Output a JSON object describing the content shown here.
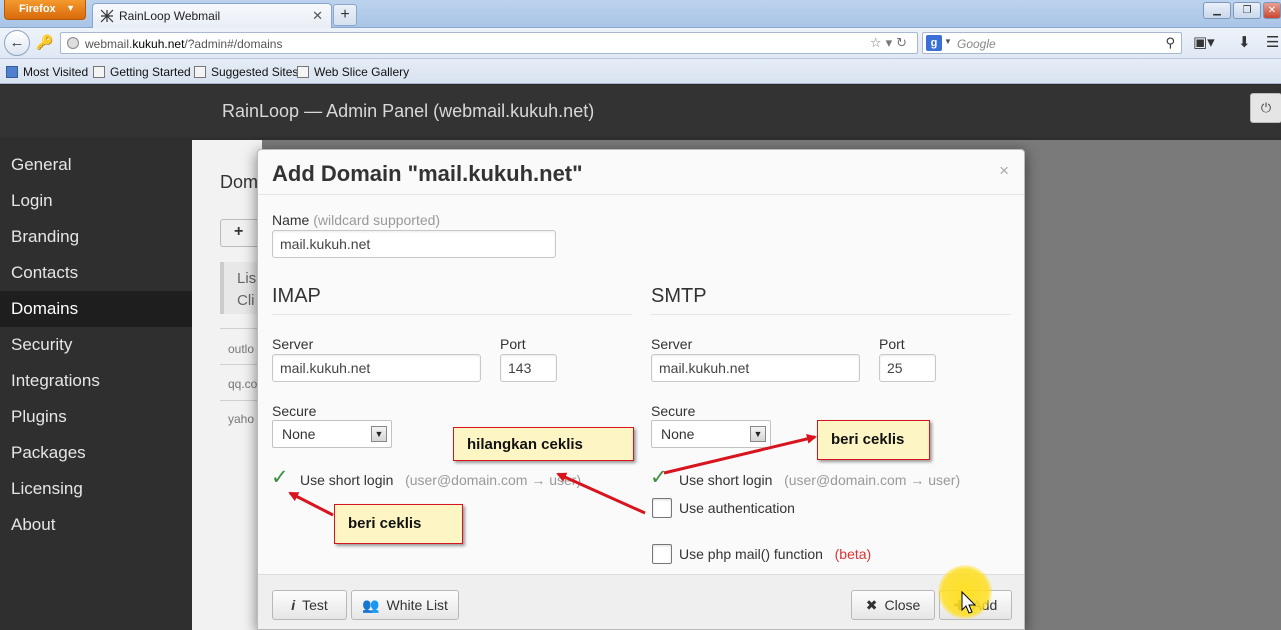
{
  "browser": {
    "menu_button": "Firefox",
    "tab_title": "RainLoop Webmail",
    "new_tab_label": "+",
    "url_prefix": "webmail.",
    "url_domain": "kukuh.net",
    "url_suffix": "/?admin#/domains",
    "search_placeholder": "Google",
    "bookmarks": [
      "Most Visited",
      "Getting Started",
      "Suggested Sites",
      "Web Slice Gallery"
    ]
  },
  "app": {
    "title": "RainLoop — Admin Panel  (webmail.kukuh.net)",
    "sidebar": [
      {
        "label": "General"
      },
      {
        "label": "Login"
      },
      {
        "label": "Branding"
      },
      {
        "label": "Contacts"
      },
      {
        "label": "Domains",
        "active": true
      },
      {
        "label": "Security"
      },
      {
        "label": "Integrations"
      },
      {
        "label": "Plugins"
      },
      {
        "label": "Packages"
      },
      {
        "label": "Licensing"
      },
      {
        "label": "About"
      }
    ],
    "page_heading": "Dom",
    "add_button_icon": "+",
    "info_line1": "Lis",
    "info_line2": "Cli",
    "domain_rows": [
      "outlo",
      "qq.co",
      "yaho"
    ]
  },
  "modal": {
    "title": "Add Domain \"mail.kukuh.net\"",
    "close_glyph": "×",
    "name_label": "Name",
    "name_hint": "(wildcard supported)",
    "name_value": "mail.kukuh.net",
    "imap": {
      "heading": "IMAP",
      "server_label": "Server",
      "server_value": "mail.kukuh.net",
      "port_label": "Port",
      "port_value": "143",
      "secure_label": "Secure",
      "secure_value": "None",
      "short_login_label": "Use short login",
      "short_login_hint": "(user@domain.com → user)",
      "short_login_checked": true
    },
    "smtp": {
      "heading": "SMTP",
      "server_label": "Server",
      "server_value": "mail.kukuh.net",
      "port_label": "Port",
      "port_value": "25",
      "secure_label": "Secure",
      "secure_value": "None",
      "short_login_label": "Use short login",
      "short_login_hint": "(user@domain.com → user)",
      "short_login_checked": true,
      "auth_label": "Use authentication",
      "php_mail_label": "Use php mail() function",
      "php_mail_badge": "(beta)"
    },
    "footer": {
      "test_label": "Test",
      "whitelist_label": "White List",
      "close_label": "Close",
      "add_label": "Add"
    }
  },
  "annotations": {
    "note_imap_check": "beri ceklis",
    "note_uncheck": "hilangkan ceklis",
    "note_smtp_check": "beri ceklis"
  },
  "colors": {
    "app_background": "#2f2f2f",
    "active_sidebar": "#1e1e1e",
    "check_green": "#3a8f3a",
    "arrow_red": "#d8141e",
    "note_fill": "#fdf6c4",
    "cursor_highlight": "#ffde1e"
  }
}
